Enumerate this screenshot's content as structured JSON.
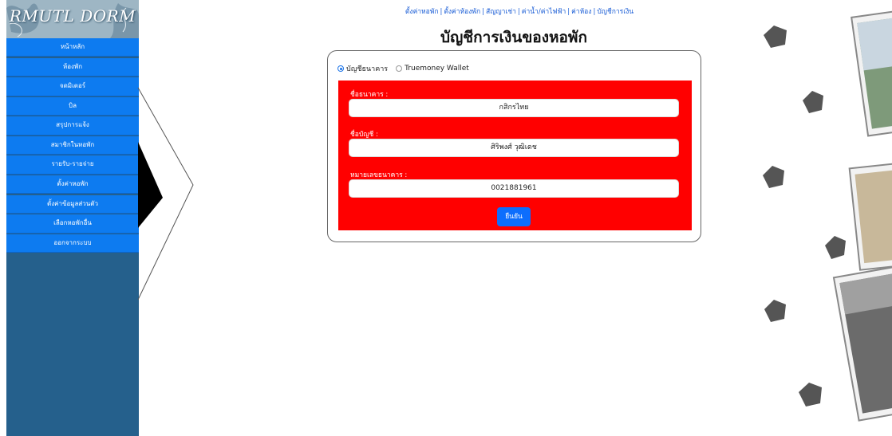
{
  "sidebar": {
    "logo_text": "RMUTL DORM",
    "menu": [
      {
        "label": "หน้าหลัก"
      },
      {
        "label": "ห้องพัก"
      },
      {
        "label": "จดมิเตอร์"
      },
      {
        "label": "บิล"
      },
      {
        "label": "สรุปการแจ้ง"
      },
      {
        "label": "สมาชิกในหอพัก"
      },
      {
        "label": "รายรับ-รายจ่าย"
      },
      {
        "label": "ตั้งค่าหอพัก"
      },
      {
        "label": "ตั้งค่าข้อมูลส่วนตัว"
      },
      {
        "label": "เลือกหอพักอื่น"
      },
      {
        "label": "ออกจากระบบ"
      }
    ]
  },
  "topnav": {
    "links": [
      {
        "label": "ตั้งค่าหอพัก"
      },
      {
        "label": "ตั้งค่าห้องพัก"
      },
      {
        "label": "สัญญาเช่า"
      },
      {
        "label": "ค่าน้ำ/ค่าไฟฟ้า"
      },
      {
        "label": "ค่าห้อง"
      },
      {
        "label": "บัญชีการเงิน"
      }
    ],
    "separator": "|"
  },
  "page_title": "บัญชีการเงินของหอพัก",
  "form": {
    "radio_bank": "บัญชีธนาคาร",
    "radio_truemoney": "Truemoney Wallet",
    "selected": "bank",
    "bank_name_label": "ชื่อธนาคาร :",
    "bank_name_value": "กสิกรไทย",
    "account_name_label": "ชื่อบัญชี :",
    "account_name_value": "ศิริพงศ์ วุฒิเดช",
    "account_number_label": "หมายเลขธนาคาร :",
    "account_number_value": "0021881961",
    "confirm_label": "ยืนยัน"
  },
  "colors": {
    "sidebar_bg": "#25608c",
    "menu_bg": "#0d7bf0",
    "form_bg": "#ff0000",
    "button_bg": "#0d6efd",
    "link": "#1a5dd6"
  }
}
